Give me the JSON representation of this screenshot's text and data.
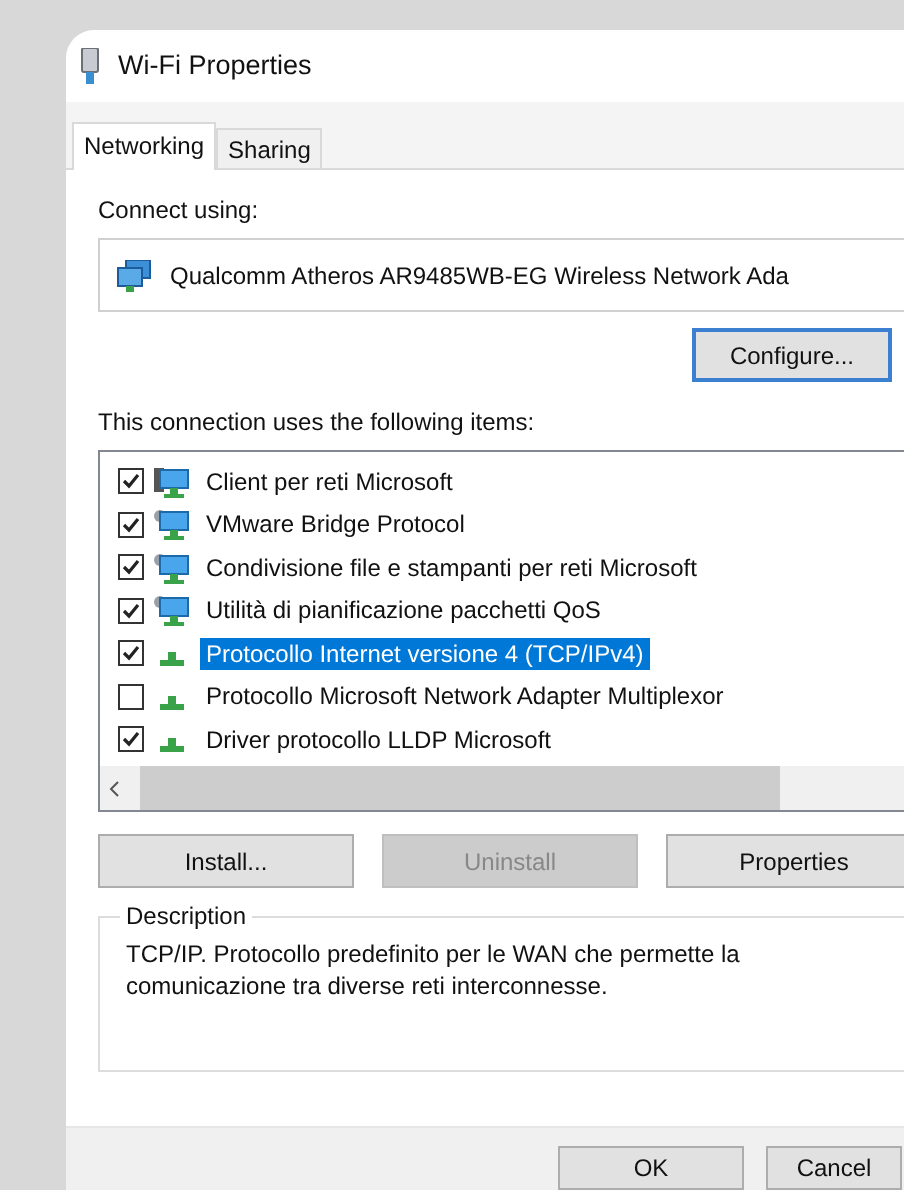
{
  "window": {
    "title": "Wi-Fi Properties"
  },
  "tabs": [
    {
      "label": "Networking",
      "selected": true
    },
    {
      "label": "Sharing",
      "selected": false
    }
  ],
  "connect_using": {
    "label": "Connect using:",
    "adapter": "Qualcomm Atheros AR9485WB-EG Wireless Network Ada",
    "button": "Configure..."
  },
  "items": {
    "label": "This connection uses the following items:",
    "list": [
      {
        "kind": "client",
        "name": "Client per reti Microsoft",
        "checked": true,
        "selected": false
      },
      {
        "kind": "service",
        "name": "VMware Bridge Protocol",
        "checked": true,
        "selected": false
      },
      {
        "kind": "service",
        "name": "Condivisione file e stampanti per reti Microsoft",
        "checked": true,
        "selected": false
      },
      {
        "kind": "service",
        "name": "Utilità di pianificazione pacchetti QoS",
        "checked": true,
        "selected": false
      },
      {
        "kind": "protocol",
        "name": "Protocollo Internet versione 4 (TCP/IPv4)",
        "checked": true,
        "selected": true
      },
      {
        "kind": "protocol",
        "name": "Protocollo Microsoft Network Adapter Multiplexor",
        "checked": false,
        "selected": false
      },
      {
        "kind": "protocol",
        "name": "Driver protocollo LLDP Microsoft",
        "checked": true,
        "selected": false
      }
    ]
  },
  "actions": [
    {
      "label": "Install...",
      "disabled": false
    },
    {
      "label": "Uninstall",
      "disabled": true
    },
    {
      "label": "Properties",
      "disabled": false
    }
  ],
  "description": {
    "title": "Description",
    "text": "TCP/IP. Protocollo predefinito per le WAN che permette la comunicazione tra diverse reti interconnesse."
  },
  "footer": [
    "OK",
    "Cancel"
  ]
}
